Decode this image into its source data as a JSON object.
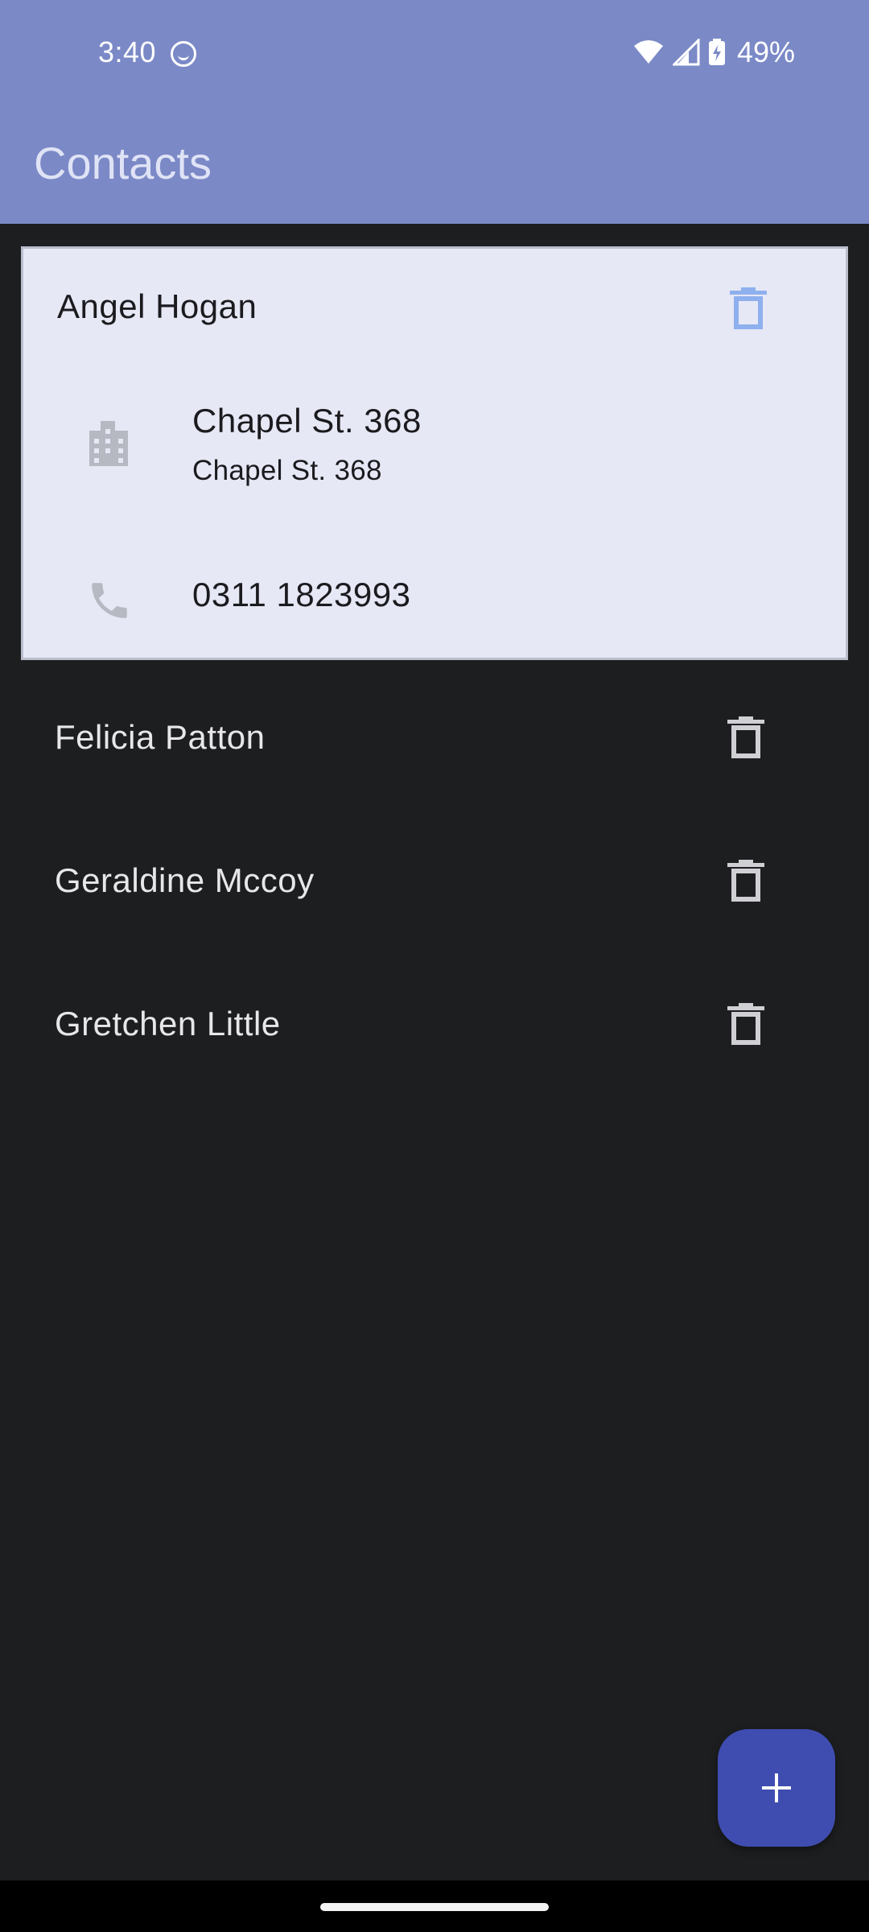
{
  "status_bar": {
    "time": "3:40",
    "battery": "49%"
  },
  "app_bar": {
    "title": "Contacts"
  },
  "contacts": [
    {
      "name": "Angel Hogan",
      "expanded": true,
      "address_line1": "Chapel St. 368",
      "address_line2": "Chapel St. 368",
      "phone": "0311 1823993"
    },
    {
      "name": "Felicia Patton",
      "expanded": false
    },
    {
      "name": "Geraldine Mccoy",
      "expanded": false
    },
    {
      "name": "Gretchen Little",
      "expanded": false
    }
  ],
  "icons": {
    "delete": "trash-icon",
    "address": "business-icon",
    "phone": "phone-icon",
    "add": "plus-icon"
  },
  "colors": {
    "app_bar": "#7b89c7",
    "background": "#1d1e20",
    "expanded_card": "#e6e8f5",
    "fab": "#3f4db1",
    "expanded_delete_icon": "#8fb0ee"
  }
}
